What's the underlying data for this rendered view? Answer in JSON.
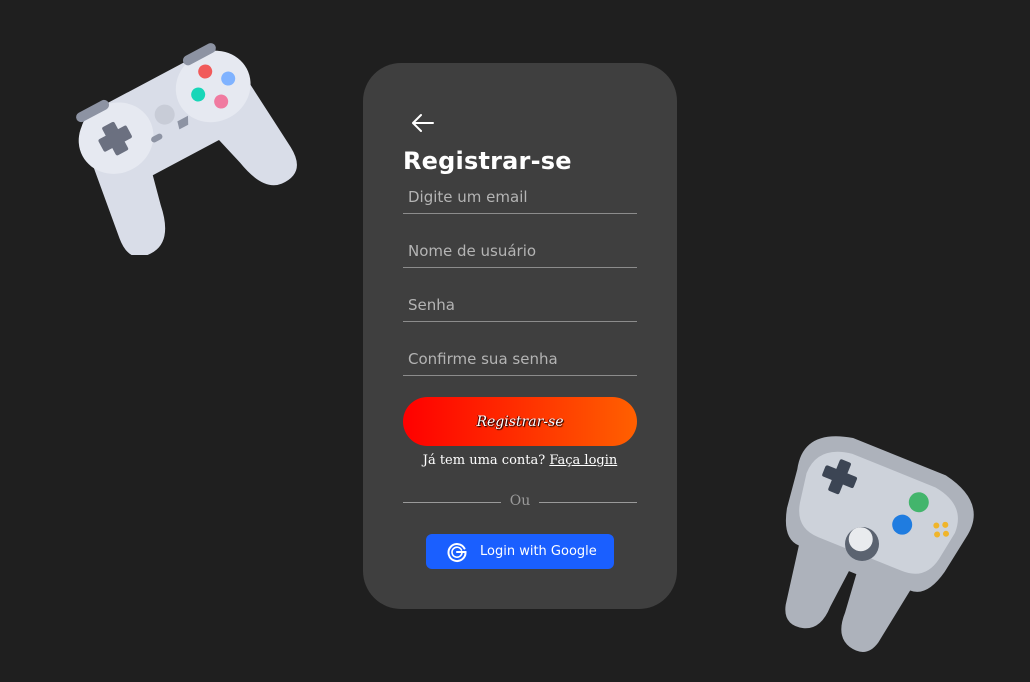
{
  "form": {
    "title": "Registrar-se",
    "fields": [
      {
        "placeholder": "Digite um email",
        "value": ""
      },
      {
        "placeholder": "Nome de usuário",
        "value": ""
      },
      {
        "placeholder": "Senha",
        "value": ""
      },
      {
        "placeholder": "Confirme sua senha",
        "value": ""
      }
    ],
    "submit_label": "Registrar-se",
    "have_account_text": "Já tem uma conta?",
    "login_link": "Faça login",
    "divider_text": "Ou",
    "google_label": "Login with Google"
  },
  "icons": {
    "back": "arrow-left-icon",
    "google": "google-icon",
    "controller_left": "gamepad-icon",
    "controller_right": "n64-controller-icon"
  },
  "colors": {
    "background": "#1f1f1f",
    "card": "#3f3f3f",
    "submit_gradient_start": "#ff0000",
    "submit_gradient_end": "#ff6000",
    "google_button": "#1a5fff"
  }
}
